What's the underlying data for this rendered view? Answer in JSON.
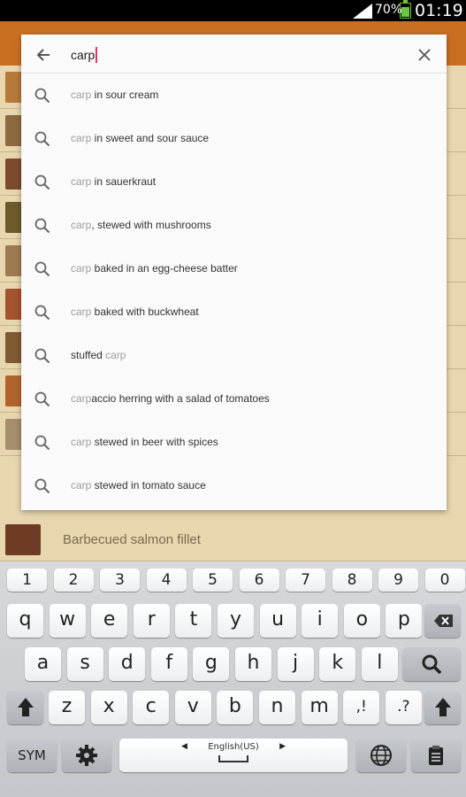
{
  "status_bar": {
    "battery_percent": "70%",
    "time": "01:19"
  },
  "recipe_list": {
    "visible_item_title": "Barbecued salmon fillet"
  },
  "search": {
    "query": "carp",
    "suggestions": [
      {
        "dim": "carp",
        "rest": " in sour cream"
      },
      {
        "dim": "carp",
        "rest": " in sweet and sour sauce"
      },
      {
        "dim": "carp",
        "rest": " in sauerkraut"
      },
      {
        "dim": "carp",
        "rest": ", stewed with mushrooms"
      },
      {
        "dim": "carp",
        "rest": " baked in an egg-cheese batter"
      },
      {
        "dim": "carp",
        "rest": " baked with buckwheat"
      },
      {
        "prefix": "stuffed ",
        "dim": "carp",
        "rest": ""
      },
      {
        "dim": "carp",
        "rest": "accio herring with a salad of tomatoes"
      },
      {
        "dim": "carp",
        "rest": " stewed in beer with spices"
      },
      {
        "dim": "carp",
        "rest": " stewed in tomato sauce"
      }
    ]
  },
  "keyboard": {
    "numbers": [
      "1",
      "2",
      "3",
      "4",
      "5",
      "6",
      "7",
      "8",
      "9",
      "0"
    ],
    "row1": [
      "q",
      "w",
      "e",
      "r",
      "t",
      "y",
      "u",
      "i",
      "o",
      "p"
    ],
    "row2": [
      "a",
      "s",
      "d",
      "f",
      "g",
      "h",
      "j",
      "k",
      "l"
    ],
    "row3": [
      "z",
      "x",
      "c",
      "v",
      "b",
      "n",
      "m",
      ",!",
      ".?"
    ],
    "sym_label": "SYM",
    "space_language": "English(US)"
  },
  "colors": {
    "app_bar": "#c96f22",
    "list_background": "#e7d6ae",
    "caret": "#e0336a",
    "battery": "#6cc644"
  }
}
